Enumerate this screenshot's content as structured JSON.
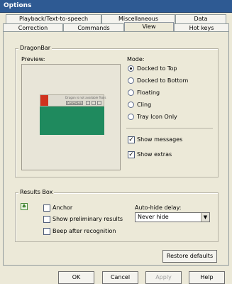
{
  "window": {
    "title": "Options"
  },
  "tabs": {
    "row1": [
      "Playback/Text-to-speech",
      "Miscellaneous",
      "Data"
    ],
    "row2": [
      "Correction",
      "Commands",
      "View",
      "Hot keys"
    ],
    "active": "View"
  },
  "dragonbar": {
    "group_label": "DragonBar",
    "preview_label": "Preview:",
    "mode_label": "Mode:",
    "modes": [
      "Docked to Top",
      "Docked to Bottom",
      "Floating",
      "Cling",
      "Tray Icon Only"
    ],
    "selected_mode": "Docked to Top",
    "show_messages": {
      "label": "Show messages",
      "checked": true
    },
    "show_extras": {
      "label": "Show extras",
      "checked": true
    },
    "preview_titlebar_text": "Dragon is not available Tools",
    "preview_button_text": "Correction"
  },
  "results_box": {
    "group_label": "Results Box",
    "anchor": {
      "label": "Anchor",
      "checked": false
    },
    "show_preliminary": {
      "label": "Show preliminary results",
      "checked": false
    },
    "beep": {
      "label": "Beep after recognition",
      "checked": false
    },
    "auto_hide_label": "Auto-hide delay:",
    "auto_hide_value": "Never hide"
  },
  "buttons": {
    "restore_defaults": "Restore defaults",
    "ok": "OK",
    "cancel": "Cancel",
    "apply": "Apply",
    "help": "Help"
  }
}
